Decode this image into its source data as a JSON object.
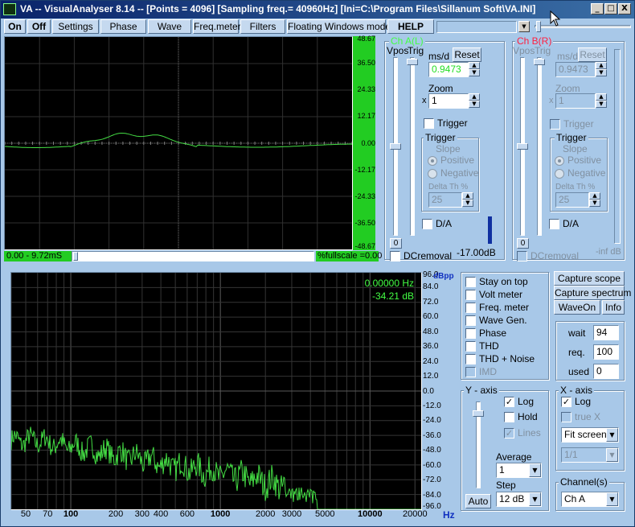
{
  "window": {
    "title": "VA -- VisualAnalyser 8.14 --  [Points = 4096]  [Sampling freq.= 40960Hz]  [Ini=C:\\Program Files\\Sillanum Soft\\VA.INI]",
    "minimize": "_",
    "maximize": "□",
    "close": "X"
  },
  "toolbar": {
    "on": "On",
    "off": "Off",
    "settings": "Settings",
    "phase": "Phase",
    "wave": "Wave",
    "freqmeter": "Freq.meter",
    "filters": "Filters",
    "floating": "Floating Windows mode",
    "help": "HELP"
  },
  "scope": {
    "y_ticks": [
      "48.67",
      "36.50",
      "24.33",
      "12.17",
      "0.00",
      "-12.17",
      "-24.33",
      "-36.50",
      "-48.67"
    ],
    "time_range": "0.00 - 9.72mS",
    "fullscale": "%fullscale =0.00",
    "trace_color": "#44dd44"
  },
  "chA": {
    "title": "Ch A(L)",
    "vpos": "Vpos",
    "trig": "Trig",
    "msd_label": "ms/d",
    "reset": "Reset",
    "msd_value": "0.9473",
    "zoom_label": "Zoom",
    "zoom_x": "x",
    "zoom_value": "1",
    "trigger_check": "Trigger",
    "trigger_group": "Trigger",
    "slope": "Slope",
    "positive": "Positive",
    "negative": "Negative",
    "deltath": "Delta Th %",
    "deltath_value": "25",
    "da": "D/A",
    "zero": "0",
    "dcremoval": "DCremoval",
    "level": "-17.00dB"
  },
  "chB": {
    "title": "Ch B(R)",
    "vpos": "Vpos",
    "trig": "Trig",
    "msd_label": "ms/d",
    "reset": "Reset",
    "msd_value": "0.9473",
    "zoom_label": "Zoom",
    "zoom_x": "x",
    "zoom_value": "1",
    "trigger_check": "Trigger",
    "trigger_group": "Trigger",
    "slope": "Slope",
    "positive": "Positive",
    "negative": "Negative",
    "deltath": "Delta Th %",
    "deltath_value": "25",
    "da": "D/A",
    "zero": "0",
    "dcremoval": "DCremoval",
    "level": "-inf dB"
  },
  "spectrum": {
    "freq_readout": "0.00000 Hz",
    "db_readout": "-34.21 dB",
    "unit": "dBpp",
    "hz": "Hz",
    "y_ticks": [
      "96.0",
      "84.0",
      "72.0",
      "60.0",
      "48.0",
      "36.0",
      "24.0",
      "12.0",
      "0.0",
      "-12.0",
      "-24.0",
      "-36.0",
      "-48.0",
      "-60.0",
      "-72.0",
      "-84.0",
      "-96.0"
    ],
    "x_ticks": [
      {
        "label": "50",
        "bold": false
      },
      {
        "label": "70",
        "bold": false
      },
      {
        "label": "100",
        "bold": true
      },
      {
        "label": "200",
        "bold": false
      },
      {
        "label": "300",
        "bold": false
      },
      {
        "label": "400",
        "bold": false
      },
      {
        "label": "600",
        "bold": false
      },
      {
        "label": "1000",
        "bold": true
      },
      {
        "label": "2000",
        "bold": false
      },
      {
        "label": "3000",
        "bold": false
      },
      {
        "label": "5000",
        "bold": false
      },
      {
        "label": "10000",
        "bold": true
      },
      {
        "label": "20000",
        "bold": false
      }
    ]
  },
  "options": {
    "stay_on_top": "Stay on top",
    "volt_meter": "Volt meter",
    "freq_meter": "Freq. meter",
    "wave_gen": "Wave Gen.",
    "phase": "Phase",
    "thd": "THD",
    "thd_noise": "THD + Noise",
    "imd": "IMD"
  },
  "capture": {
    "scope": "Capture scope",
    "spectrum": "Capture spectrum",
    "waveon": "WaveOn",
    "info": "Info"
  },
  "stats": {
    "wait_label": "wait",
    "wait": "94",
    "req_label": "req.",
    "req": "100",
    "used_label": "used",
    "used": "0"
  },
  "yaxis": {
    "title": "Y - axis",
    "log": "Log",
    "hold": "Hold",
    "lines": "Lines",
    "average": "Average",
    "average_value": "1",
    "step": "Step",
    "step_value": "12 dB",
    "auto": "Auto"
  },
  "xaxis": {
    "title": "X - axis",
    "log": "Log",
    "truex": "true X",
    "fit": "Fit screen",
    "ratio": "1/1"
  },
  "channels": {
    "title": "Channel(s)",
    "value": "Ch A"
  }
}
